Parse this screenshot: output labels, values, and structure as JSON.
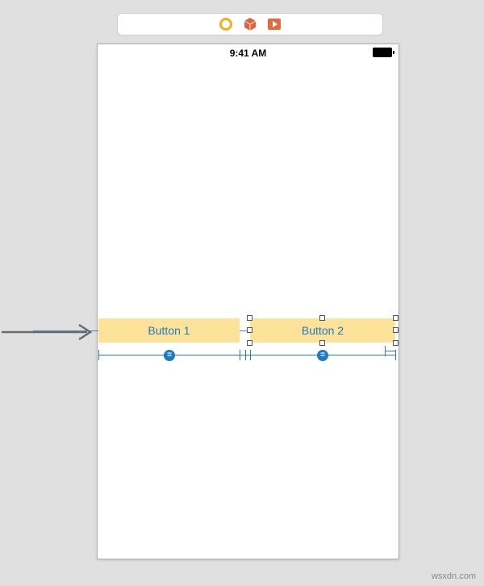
{
  "toolbar": {
    "icons": {
      "stop": "stop-icon",
      "cube": "cube-icon",
      "play": "play-icon"
    }
  },
  "statusbar": {
    "time": "9:41 AM"
  },
  "buttons": {
    "b1": "Button 1",
    "b2": "Button 2"
  },
  "constraint_badge": "=",
  "watermark": "wsxdn.com"
}
